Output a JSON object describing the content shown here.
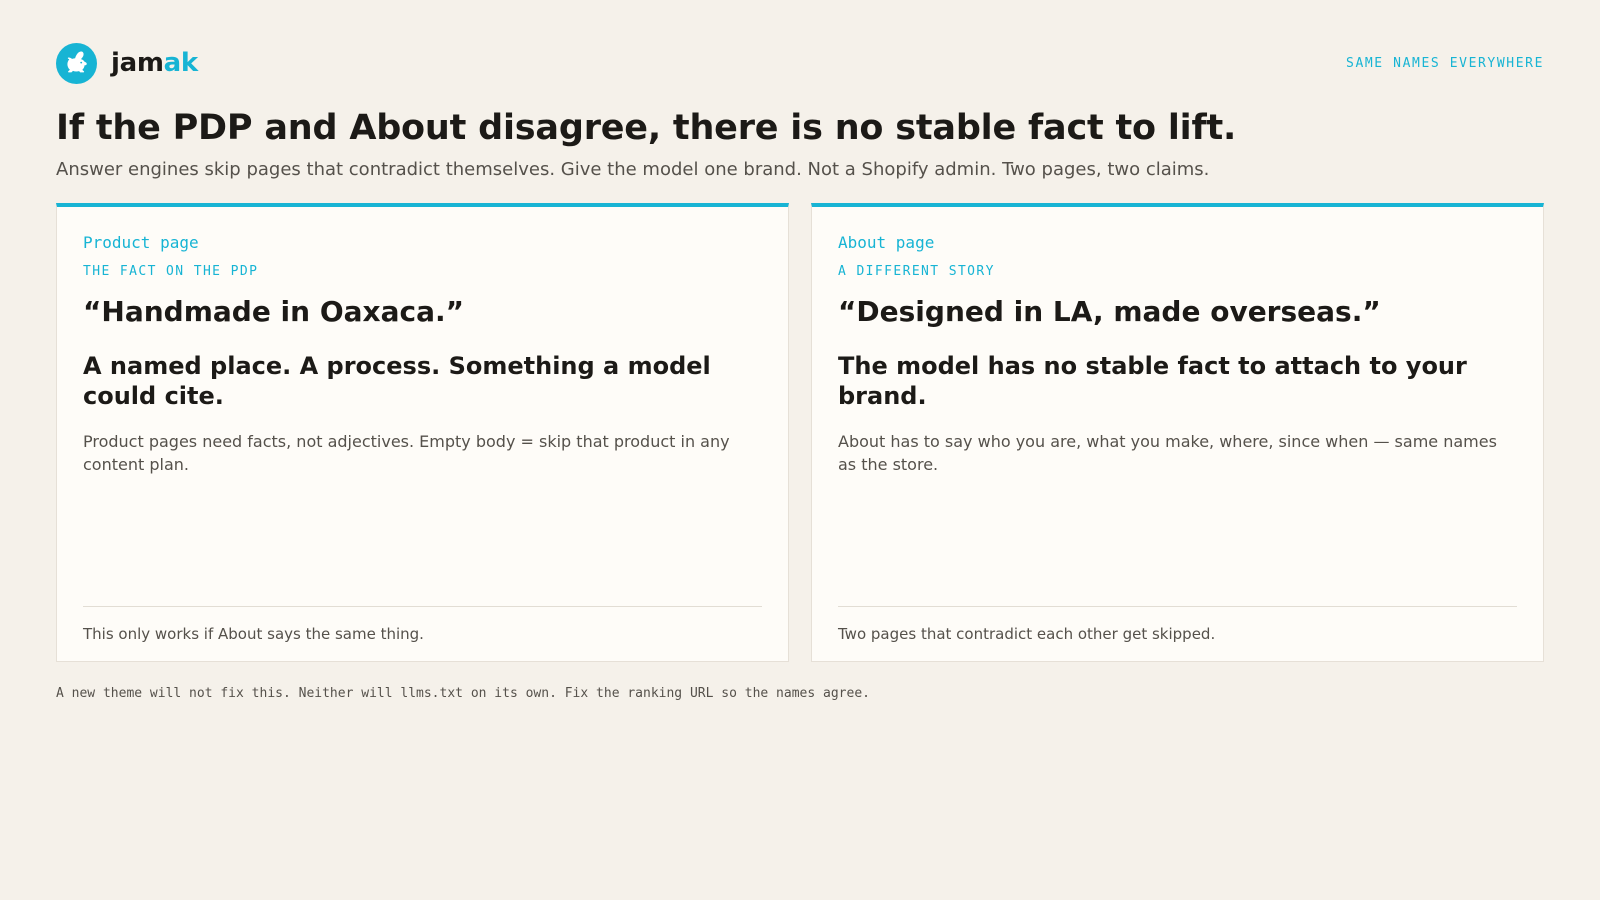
{
  "header": {
    "brand_part1": "jam",
    "brand_part2": "ak",
    "tagline": "SAME NAMES EVERYWHERE",
    "logo_icon": "rabbit-icon"
  },
  "headline": "If the PDP and About disagree, there is no stable fact to lift.",
  "subtitle": "Answer engines skip pages that contradict themselves. Give the model one brand. Not a Shopify admin. Two pages, two claims.",
  "cards": [
    {
      "kicker": "Product page",
      "eyebrow": "THE FACT ON THE PDP",
      "quote": "“Handmade in Oaxaca.”",
      "heading": "A named place. A process. Something a model could cite.",
      "body": "Product pages need facts, not adjectives. Empty body = skip that product in any content plan.",
      "footer": "This only works if About says the same thing."
    },
    {
      "kicker": "About page",
      "eyebrow": "A DIFFERENT STORY",
      "quote": "“Designed in LA, made overseas.”",
      "heading": "The model has no stable fact to attach to your brand.",
      "body": "About has to say who you are, what you make, where, since when — same names as the store.",
      "footer": "Two pages that contradict each other get skipped."
    }
  ],
  "footnote": "A new theme will not fix this. Neither will llms.txt on its own. Fix the ranking URL so the names agree.",
  "colors": {
    "accent": "#17b4d4",
    "background": "#f5f1ea",
    "card": "#fefcf8",
    "text": "#1c1a17",
    "muted": "#55514b"
  }
}
